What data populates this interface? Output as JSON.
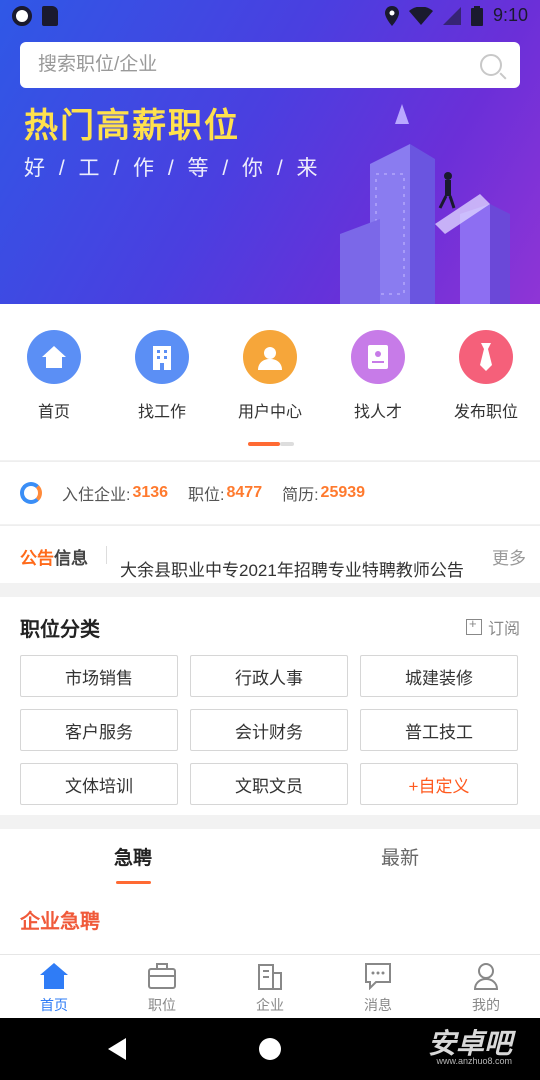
{
  "status_bar": {
    "time": "9:10"
  },
  "search": {
    "placeholder": "搜索职位/企业"
  },
  "banner": {
    "title": "热门高薪职位",
    "subtitle": "好 / 工 / 作 / 等 / 你 / 来"
  },
  "nav": {
    "items": [
      {
        "label": "首页",
        "icon": "home-icon",
        "color": "#5b8ff5"
      },
      {
        "label": "找工作",
        "icon": "building-icon",
        "color": "#5b8ff5"
      },
      {
        "label": "用户中心",
        "icon": "user-icon",
        "color": "#f6a63a"
      },
      {
        "label": "找人才",
        "icon": "resume-icon",
        "color": "#c77be8"
      },
      {
        "label": "发布职位",
        "icon": "tie-icon",
        "color": "#f5607a"
      }
    ]
  },
  "stats": {
    "companies_label": "入住企业:",
    "companies": "3136",
    "jobs_label": "职位:",
    "jobs": "8477",
    "resumes_label": "简历:",
    "resumes": "25939"
  },
  "notice": {
    "logo_a": "公告",
    "logo_b": "信息",
    "text": "大余县职业中专2021年招聘专业特聘教师公告",
    "more": "更多"
  },
  "categories": {
    "title": "职位分类",
    "subscribe": "订阅",
    "items": [
      "市场销售",
      "行政人事",
      "城建装修",
      "客户服务",
      "会计财务",
      "普工技工",
      "文体培训",
      "文职文员",
      "+自定义"
    ]
  },
  "tabs": {
    "items": [
      "急聘",
      "最新"
    ],
    "section_title": "企业急聘"
  },
  "bottom_nav": {
    "items": [
      "首页",
      "职位",
      "企业",
      "消息",
      "我的"
    ]
  },
  "watermark": {
    "text": "安卓吧",
    "url": "www.anzhuo8.com"
  },
  "colors": {
    "accent": "#ff6a33",
    "brand_blue": "#2f7cf6",
    "banner_gold": "#ffe14d"
  }
}
